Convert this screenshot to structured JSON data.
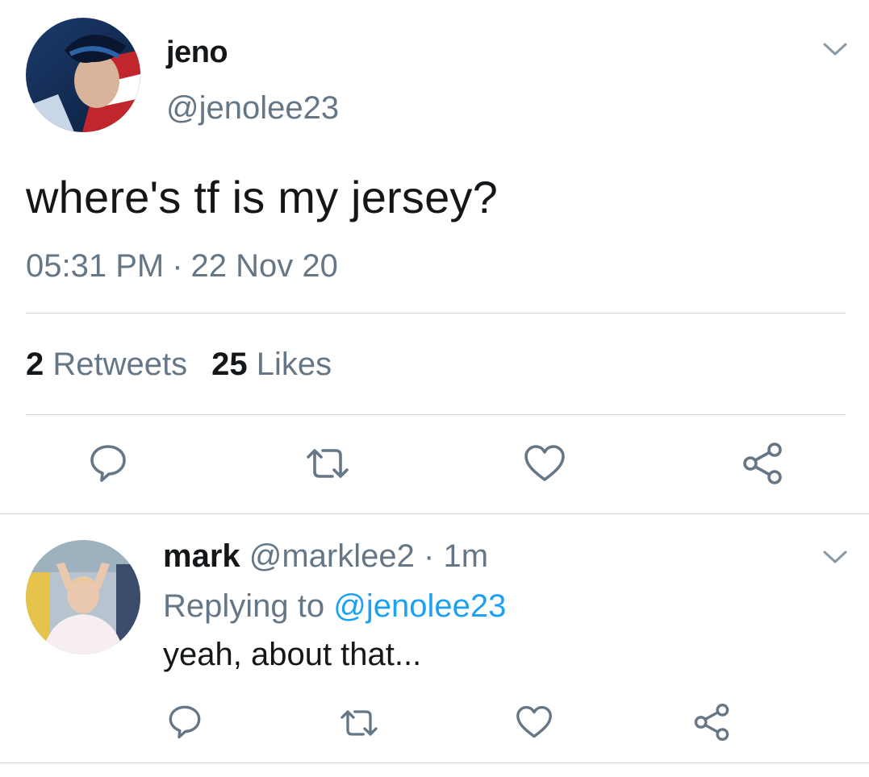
{
  "tweet": {
    "author_name": "jeno",
    "author_handle": "@jenolee23",
    "text": "where's tf is my jersey?",
    "time": "05:31 PM",
    "date_separator": "·",
    "date": "22 Nov 20",
    "retweets_count": "2",
    "retweets_label": "Retweets",
    "likes_count": "25",
    "likes_label": "Likes"
  },
  "reply": {
    "author_name": "mark",
    "author_handle": "@marklee2",
    "separator": "·",
    "age": "1m",
    "replying_label": "Replying to",
    "replying_to": "@jenolee23",
    "text": "yeah, about that..."
  },
  "icons": {
    "reply": "reply-icon",
    "retweet": "retweet-icon",
    "like": "heart-icon",
    "share": "share-icon",
    "menu": "chevron-down-icon"
  },
  "colors": {
    "text_primary": "#14171a",
    "text_secondary": "#657786",
    "link": "#1da1f2",
    "icon": "#657786",
    "divider": "#ccd6dd"
  }
}
